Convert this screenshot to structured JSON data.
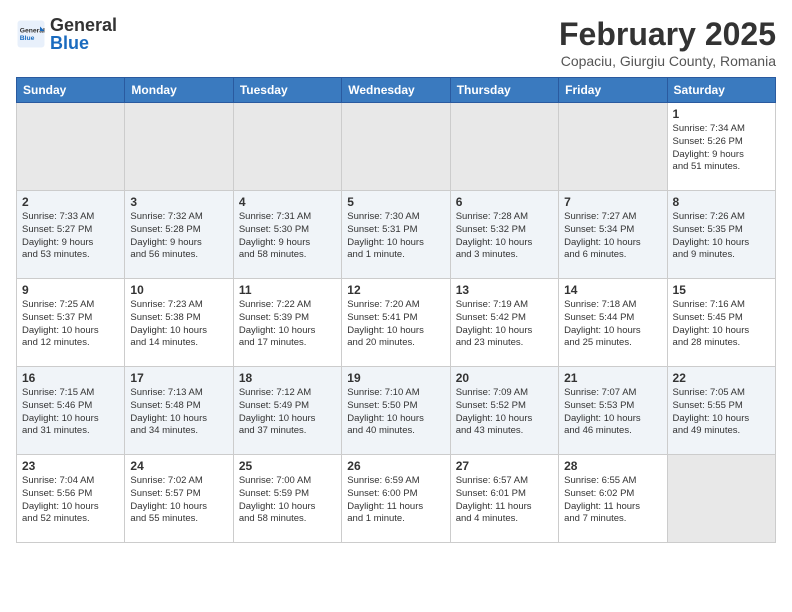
{
  "header": {
    "logo_general": "General",
    "logo_blue": "Blue",
    "month_year": "February 2025",
    "location": "Copaciu, Giurgiu County, Romania"
  },
  "weekdays": [
    "Sunday",
    "Monday",
    "Tuesday",
    "Wednesday",
    "Thursday",
    "Friday",
    "Saturday"
  ],
  "weeks": [
    [
      {
        "day": "",
        "info": ""
      },
      {
        "day": "",
        "info": ""
      },
      {
        "day": "",
        "info": ""
      },
      {
        "day": "",
        "info": ""
      },
      {
        "day": "",
        "info": ""
      },
      {
        "day": "",
        "info": ""
      },
      {
        "day": "1",
        "info": "Sunrise: 7:34 AM\nSunset: 5:26 PM\nDaylight: 9 hours\nand 51 minutes."
      }
    ],
    [
      {
        "day": "2",
        "info": "Sunrise: 7:33 AM\nSunset: 5:27 PM\nDaylight: 9 hours\nand 53 minutes."
      },
      {
        "day": "3",
        "info": "Sunrise: 7:32 AM\nSunset: 5:28 PM\nDaylight: 9 hours\nand 56 minutes."
      },
      {
        "day": "4",
        "info": "Sunrise: 7:31 AM\nSunset: 5:30 PM\nDaylight: 9 hours\nand 58 minutes."
      },
      {
        "day": "5",
        "info": "Sunrise: 7:30 AM\nSunset: 5:31 PM\nDaylight: 10 hours\nand 1 minute."
      },
      {
        "day": "6",
        "info": "Sunrise: 7:28 AM\nSunset: 5:32 PM\nDaylight: 10 hours\nand 3 minutes."
      },
      {
        "day": "7",
        "info": "Sunrise: 7:27 AM\nSunset: 5:34 PM\nDaylight: 10 hours\nand 6 minutes."
      },
      {
        "day": "8",
        "info": "Sunrise: 7:26 AM\nSunset: 5:35 PM\nDaylight: 10 hours\nand 9 minutes."
      }
    ],
    [
      {
        "day": "9",
        "info": "Sunrise: 7:25 AM\nSunset: 5:37 PM\nDaylight: 10 hours\nand 12 minutes."
      },
      {
        "day": "10",
        "info": "Sunrise: 7:23 AM\nSunset: 5:38 PM\nDaylight: 10 hours\nand 14 minutes."
      },
      {
        "day": "11",
        "info": "Sunrise: 7:22 AM\nSunset: 5:39 PM\nDaylight: 10 hours\nand 17 minutes."
      },
      {
        "day": "12",
        "info": "Sunrise: 7:20 AM\nSunset: 5:41 PM\nDaylight: 10 hours\nand 20 minutes."
      },
      {
        "day": "13",
        "info": "Sunrise: 7:19 AM\nSunset: 5:42 PM\nDaylight: 10 hours\nand 23 minutes."
      },
      {
        "day": "14",
        "info": "Sunrise: 7:18 AM\nSunset: 5:44 PM\nDaylight: 10 hours\nand 25 minutes."
      },
      {
        "day": "15",
        "info": "Sunrise: 7:16 AM\nSunset: 5:45 PM\nDaylight: 10 hours\nand 28 minutes."
      }
    ],
    [
      {
        "day": "16",
        "info": "Sunrise: 7:15 AM\nSunset: 5:46 PM\nDaylight: 10 hours\nand 31 minutes."
      },
      {
        "day": "17",
        "info": "Sunrise: 7:13 AM\nSunset: 5:48 PM\nDaylight: 10 hours\nand 34 minutes."
      },
      {
        "day": "18",
        "info": "Sunrise: 7:12 AM\nSunset: 5:49 PM\nDaylight: 10 hours\nand 37 minutes."
      },
      {
        "day": "19",
        "info": "Sunrise: 7:10 AM\nSunset: 5:50 PM\nDaylight: 10 hours\nand 40 minutes."
      },
      {
        "day": "20",
        "info": "Sunrise: 7:09 AM\nSunset: 5:52 PM\nDaylight: 10 hours\nand 43 minutes."
      },
      {
        "day": "21",
        "info": "Sunrise: 7:07 AM\nSunset: 5:53 PM\nDaylight: 10 hours\nand 46 minutes."
      },
      {
        "day": "22",
        "info": "Sunrise: 7:05 AM\nSunset: 5:55 PM\nDaylight: 10 hours\nand 49 minutes."
      }
    ],
    [
      {
        "day": "23",
        "info": "Sunrise: 7:04 AM\nSunset: 5:56 PM\nDaylight: 10 hours\nand 52 minutes."
      },
      {
        "day": "24",
        "info": "Sunrise: 7:02 AM\nSunset: 5:57 PM\nDaylight: 10 hours\nand 55 minutes."
      },
      {
        "day": "25",
        "info": "Sunrise: 7:00 AM\nSunset: 5:59 PM\nDaylight: 10 hours\nand 58 minutes."
      },
      {
        "day": "26",
        "info": "Sunrise: 6:59 AM\nSunset: 6:00 PM\nDaylight: 11 hours\nand 1 minute."
      },
      {
        "day": "27",
        "info": "Sunrise: 6:57 AM\nSunset: 6:01 PM\nDaylight: 11 hours\nand 4 minutes."
      },
      {
        "day": "28",
        "info": "Sunrise: 6:55 AM\nSunset: 6:02 PM\nDaylight: 11 hours\nand 7 minutes."
      },
      {
        "day": "",
        "info": ""
      }
    ]
  ]
}
